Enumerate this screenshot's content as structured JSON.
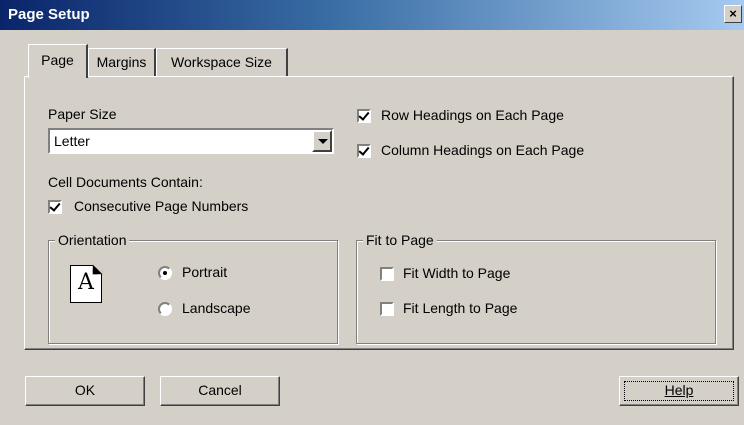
{
  "window": {
    "title": "Page Setup",
    "close_label": "×"
  },
  "tabs": [
    {
      "label": "Page",
      "active": true
    },
    {
      "label": "Margins",
      "active": false
    },
    {
      "label": "Workspace Size",
      "active": false
    }
  ],
  "paper_size": {
    "label": "Paper Size",
    "value": "Letter"
  },
  "cell_documents": {
    "label": "Cell Documents Contain:",
    "consecutive_page_numbers": {
      "label": "Consecutive Page Numbers",
      "checked": true
    }
  },
  "headings": {
    "row": {
      "label": "Row Headings on Each Page",
      "checked": true
    },
    "column": {
      "label": "Column Headings on Each Page",
      "checked": true
    }
  },
  "orientation": {
    "title": "Orientation",
    "icon_letter": "A",
    "portrait": {
      "label": "Portrait",
      "selected": true
    },
    "landscape": {
      "label": "Landscape",
      "selected": false
    }
  },
  "fit_to_page": {
    "title": "Fit to Page",
    "width": {
      "label": "Fit Width to Page",
      "checked": false
    },
    "length": {
      "label": "Fit Length to Page",
      "checked": false
    }
  },
  "buttons": {
    "ok": "OK",
    "cancel": "Cancel",
    "help": "Help"
  },
  "colors": {
    "face": "#d4d0c8",
    "title_start": "#0a246a",
    "title_end": "#a6caf0"
  }
}
